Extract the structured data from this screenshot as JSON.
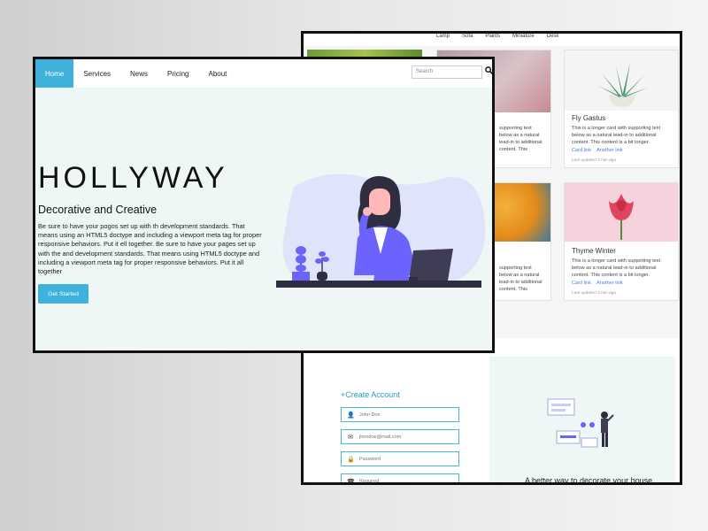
{
  "back": {
    "categories": [
      "Lamp",
      "Sofa",
      "Plants",
      "Miniature",
      "Desk"
    ],
    "cards": [
      {
        "title": "Fly Gastus",
        "text": "This is a longer card with supporting text below as a natural lead-in to additional content. This content is a bit longer.",
        "link1": "Card link",
        "link2": "Another link",
        "updated": "Last updated 3 min ago"
      },
      {
        "title": "Thyme Winter",
        "text": "This is a longer card with supporting text below as a natural lead-in to additional content. This content is a bit longer.",
        "link1": "Card link",
        "link2": "Another link",
        "updated": "Last updated 3 min ago"
      }
    ],
    "partial_text": "supporting text below as a natural lead-in to additional content. This",
    "partial_text_2": "supporting text below as a natural lead-in to additional content. This",
    "signup": {
      "heading": "+Create Account",
      "fields": [
        {
          "icon": "user-icon",
          "glyph": "👤",
          "placeholder": "John Doe"
        },
        {
          "icon": "mail-icon",
          "glyph": "✉",
          "placeholder": "jhondoe@mail.com"
        },
        {
          "icon": "lock-icon",
          "glyph": "🔒",
          "placeholder": "Password"
        },
        {
          "icon": "phone-icon",
          "glyph": "☎",
          "placeholder": "Required"
        }
      ],
      "tagline": "A better way to decorate your house"
    }
  },
  "front": {
    "nav": {
      "items": [
        "Home",
        "Services",
        "News",
        "Pricing",
        "About"
      ],
      "active": "Home",
      "search_placeholder": "Search",
      "search_icon": "search-icon"
    },
    "brand": "HOLLYWAY",
    "subtitle": "Decorative and Creative",
    "description": "Be sure to have your pogos set up with th development standards. That means using an HTML5 doctype and including a viewport meta tag for proper responsive behaviors. Put it ell together. Be sure to have your pages set up with the and development standards. That means using HTML5 doctype and including a viewport meta tag for proper responsive behaviors. Put it all together",
    "cta": "Get Started"
  },
  "colors": {
    "accent": "#3fb2dc",
    "hero_bg": "#eef6f6",
    "illustration_purple": "#6c63ff"
  }
}
